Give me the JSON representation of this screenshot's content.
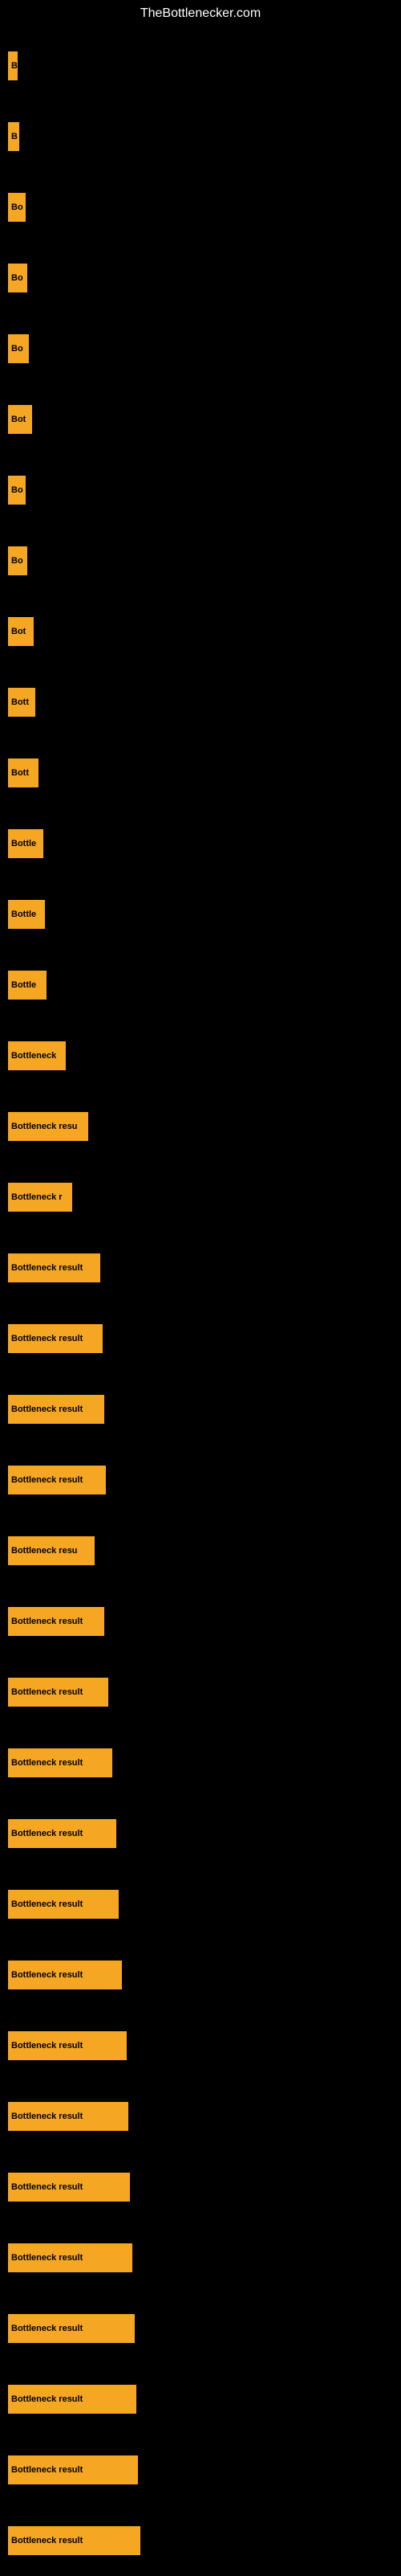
{
  "site": {
    "title": "TheBottlenecker.com"
  },
  "bars": [
    {
      "label": "B",
      "width": 12
    },
    {
      "label": "B",
      "width": 14
    },
    {
      "label": "Bo",
      "width": 22
    },
    {
      "label": "Bo",
      "width": 24
    },
    {
      "label": "Bo",
      "width": 26
    },
    {
      "label": "Bot",
      "width": 30
    },
    {
      "label": "Bo",
      "width": 22
    },
    {
      "label": "Bo",
      "width": 24
    },
    {
      "label": "Bot",
      "width": 32
    },
    {
      "label": "Bott",
      "width": 34
    },
    {
      "label": "Bott",
      "width": 38
    },
    {
      "label": "Bottle",
      "width": 44
    },
    {
      "label": "Bottle",
      "width": 46
    },
    {
      "label": "Bottle",
      "width": 48
    },
    {
      "label": "Bottleneck",
      "width": 72
    },
    {
      "label": "Bottleneck resu",
      "width": 100
    },
    {
      "label": "Bottleneck r",
      "width": 80
    },
    {
      "label": "Bottleneck result",
      "width": 115
    },
    {
      "label": "Bottleneck result",
      "width": 118
    },
    {
      "label": "Bottleneck result",
      "width": 120
    },
    {
      "label": "Bottleneck result",
      "width": 122
    },
    {
      "label": "Bottleneck resu",
      "width": 108
    },
    {
      "label": "Bottleneck result",
      "width": 120
    },
    {
      "label": "Bottleneck result",
      "width": 125
    },
    {
      "label": "Bottleneck result",
      "width": 130
    },
    {
      "label": "Bottleneck result",
      "width": 135
    },
    {
      "label": "Bottleneck result",
      "width": 138
    },
    {
      "label": "Bottleneck result",
      "width": 142
    },
    {
      "label": "Bottleneck result",
      "width": 148
    },
    {
      "label": "Bottleneck result",
      "width": 150
    },
    {
      "label": "Bottleneck result",
      "width": 152
    },
    {
      "label": "Bottleneck result",
      "width": 155
    },
    {
      "label": "Bottleneck result",
      "width": 158
    },
    {
      "label": "Bottleneck result",
      "width": 160
    },
    {
      "label": "Bottleneck result",
      "width": 162
    },
    {
      "label": "Bottleneck result",
      "width": 165
    }
  ]
}
